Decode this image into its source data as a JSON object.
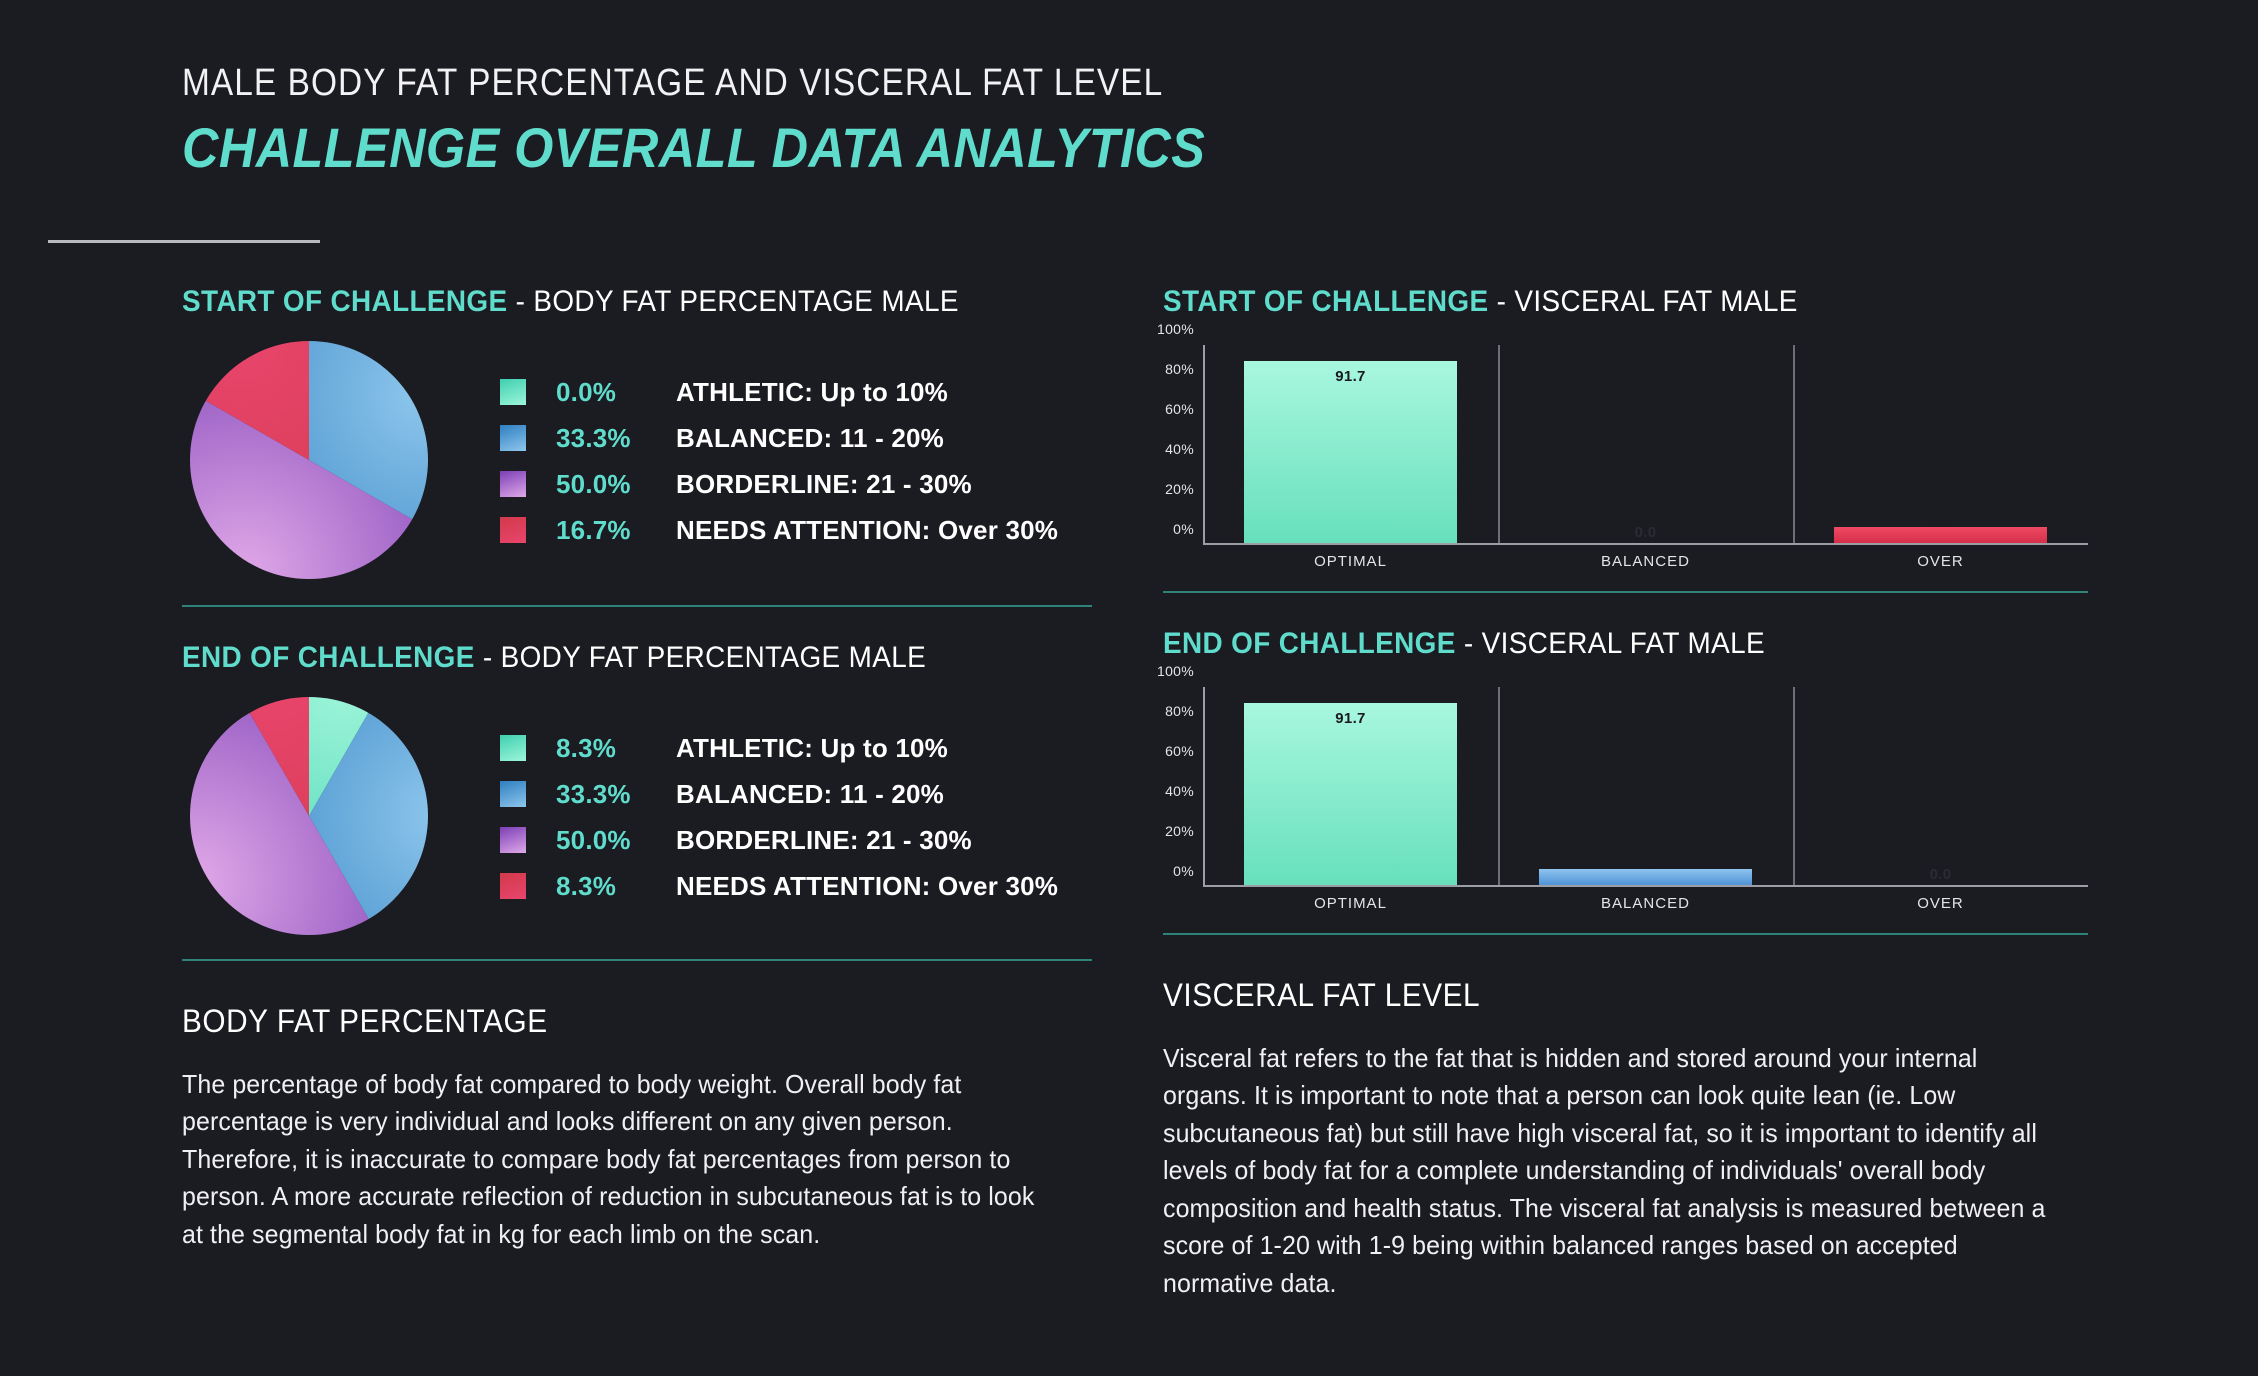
{
  "header": {
    "subtitle": "MALE BODY FAT PERCENTAGE AND VISCERAL FAT LEVEL",
    "title": "CHALLENGE OVERALL DATA ANALYTICS"
  },
  "colors": {
    "accent": "#5fdccb",
    "background": "#1b1b22",
    "divider": "#2f8279",
    "rule": "#b9b9c0",
    "athletic_from": "#3fcfb0",
    "athletic_to": "#9ef5d9",
    "balanced_from": "#2f7fc0",
    "balanced_to": "#8dc6ec",
    "borderline_from": "#7b3fb5",
    "borderline_to": "#e0a8e8",
    "attention_from": "#d23a4a",
    "attention_to": "#e8456c"
  },
  "panels": {
    "start_bodyfat": {
      "heading_highlight": "START OF CHALLENGE",
      "heading_rest": " - BODY FAT PERCENTAGE MALE"
    },
    "end_bodyfat": {
      "heading_highlight": "END OF CHALLENGE",
      "heading_rest": " - BODY FAT PERCENTAGE MALE"
    },
    "start_visceral": {
      "heading_highlight": "START OF CHALLENGE",
      "heading_rest": " - VISCERAL FAT MALE"
    },
    "end_visceral": {
      "heading_highlight": "END OF CHALLENGE",
      "heading_rest": " - VISCERAL FAT MALE"
    }
  },
  "sections": {
    "bodyfat": {
      "title": "BODY FAT PERCENTAGE",
      "body": "The percentage of body fat compared to body weight. Overall body fat percentage is very individual and looks different on any given person. Therefore, it is inaccurate to compare body fat percentages from person to person. A more accurate reflection of reduction in subcutaneous fat is to look at the segmental body fat in kg for each limb on the scan."
    },
    "visceral": {
      "title": "VISCERAL FAT LEVEL",
      "body": "Visceral fat refers to the fat that is hidden and stored around your internal organs. It is important to note that a person can look quite lean (ie. Low subcutaneous fat) but still have high visceral fat, so it is important to identify all levels of body fat for a complete understanding of individuals' overall body composition and health status. The visceral fat analysis is measured between a score of 1-20 with 1-9 being within balanced ranges based on accepted normative data."
    }
  },
  "chart_data": [
    {
      "id": "start_bodyfat_pie",
      "type": "pie",
      "title": "START OF CHALLENGE - BODY FAT PERCENTAGE MALE",
      "categories": [
        "ATHLETIC: Up to 10%",
        "BALANCED: 11 - 20%",
        "BORDERLINE: 21 - 30%",
        "NEEDS ATTENTION: Over 30%"
      ],
      "values": [
        0.0,
        33.3,
        50.0,
        16.7
      ],
      "value_labels": [
        "0.0%",
        "33.3%",
        "50.0%",
        "16.7%"
      ],
      "legend_position": "right"
    },
    {
      "id": "end_bodyfat_pie",
      "type": "pie",
      "title": "END OF CHALLENGE - BODY FAT PERCENTAGE MALE",
      "categories": [
        "ATHLETIC: Up to 10%",
        "BALANCED: 11 - 20%",
        "BORDERLINE: 21 - 30%",
        "NEEDS ATTENTION: Over 30%"
      ],
      "values": [
        8.3,
        33.3,
        50.0,
        8.3
      ],
      "value_labels": [
        "8.3%",
        "33.3%",
        "50.0%",
        "8.3%"
      ],
      "legend_position": "right"
    },
    {
      "id": "start_visceral_bar",
      "type": "bar",
      "title": "START OF CHALLENGE - VISCERAL FAT MALE",
      "categories": [
        "OPTIMAL",
        "BALANCED",
        "OVER"
      ],
      "values": [
        91.7,
        0.0,
        8.3
      ],
      "value_labels": [
        "91.7",
        "0.0",
        "8.3"
      ],
      "ytick_labels": [
        "0%",
        "20%",
        "40%",
        "60%",
        "80%",
        "100%"
      ],
      "yticks": [
        0,
        20,
        40,
        60,
        80,
        100
      ],
      "ylim": [
        0,
        100
      ],
      "xlabel": "",
      "ylabel": "",
      "grid": false
    },
    {
      "id": "end_visceral_bar",
      "type": "bar",
      "title": "END OF CHALLENGE - VISCERAL FAT MALE",
      "categories": [
        "OPTIMAL",
        "BALANCED",
        "OVER"
      ],
      "values": [
        91.7,
        8.3,
        0.0
      ],
      "value_labels": [
        "91.7",
        "8.3",
        "0.0"
      ],
      "ytick_labels": [
        "0%",
        "20%",
        "40%",
        "60%",
        "80%",
        "100%"
      ],
      "yticks": [
        0,
        20,
        40,
        60,
        80,
        100
      ],
      "ylim": [
        0,
        100
      ],
      "xlabel": "",
      "ylabel": "",
      "grid": false
    }
  ]
}
